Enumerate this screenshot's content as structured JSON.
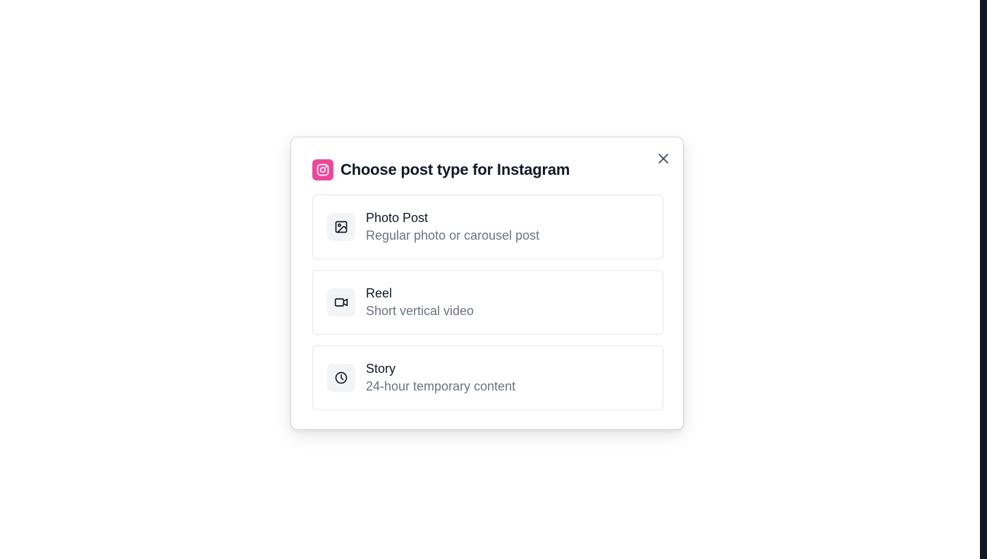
{
  "dialog": {
    "title": "Choose post type for Instagram",
    "platform_icon": "instagram-icon",
    "accent_color": "#ec4899",
    "close_icon": "close-icon"
  },
  "options": [
    {
      "label": "Photo Post",
      "description": "Regular photo or carousel post",
      "icon": "image-icon"
    },
    {
      "label": "Reel",
      "description": "Short vertical video",
      "icon": "video-icon"
    },
    {
      "label": "Story",
      "description": "24-hour temporary content",
      "icon": "clock-icon"
    }
  ]
}
